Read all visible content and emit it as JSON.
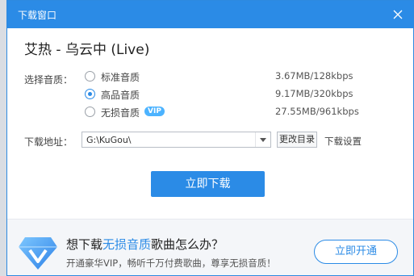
{
  "window": {
    "title": "下载窗口"
  },
  "song": {
    "title": "艾热 - 乌云中 (Live)"
  },
  "quality": {
    "label": "选择音质：",
    "options": [
      {
        "label": "标准音质",
        "size": "3.67MB/128kbps",
        "checked": false
      },
      {
        "label": "高品音质",
        "size": "9.17MB/320kbps",
        "checked": true
      },
      {
        "label": "无损音质",
        "badge": "VIP",
        "size": "27.55MB/961kbps",
        "checked": false
      }
    ]
  },
  "download": {
    "label": "下载地址：",
    "path": "G:\\KuGou\\",
    "change_dir": "更改目录",
    "settings": "下载设置",
    "button": "立即下载"
  },
  "promo": {
    "headline_pre": "想下载",
    "headline_highlight": "无损音质",
    "headline_post": "歌曲怎么办？",
    "subtext": "开通豪华VIP，畅听千万付费歌曲，尊享无损音质！",
    "button": "立即开通"
  },
  "colors": {
    "accent": "#2b8be6",
    "badge": "#4cb3ff"
  },
  "icons": {
    "close": "close-icon",
    "dropdown": "chevron-down-icon",
    "promo": "diamond-icon"
  }
}
